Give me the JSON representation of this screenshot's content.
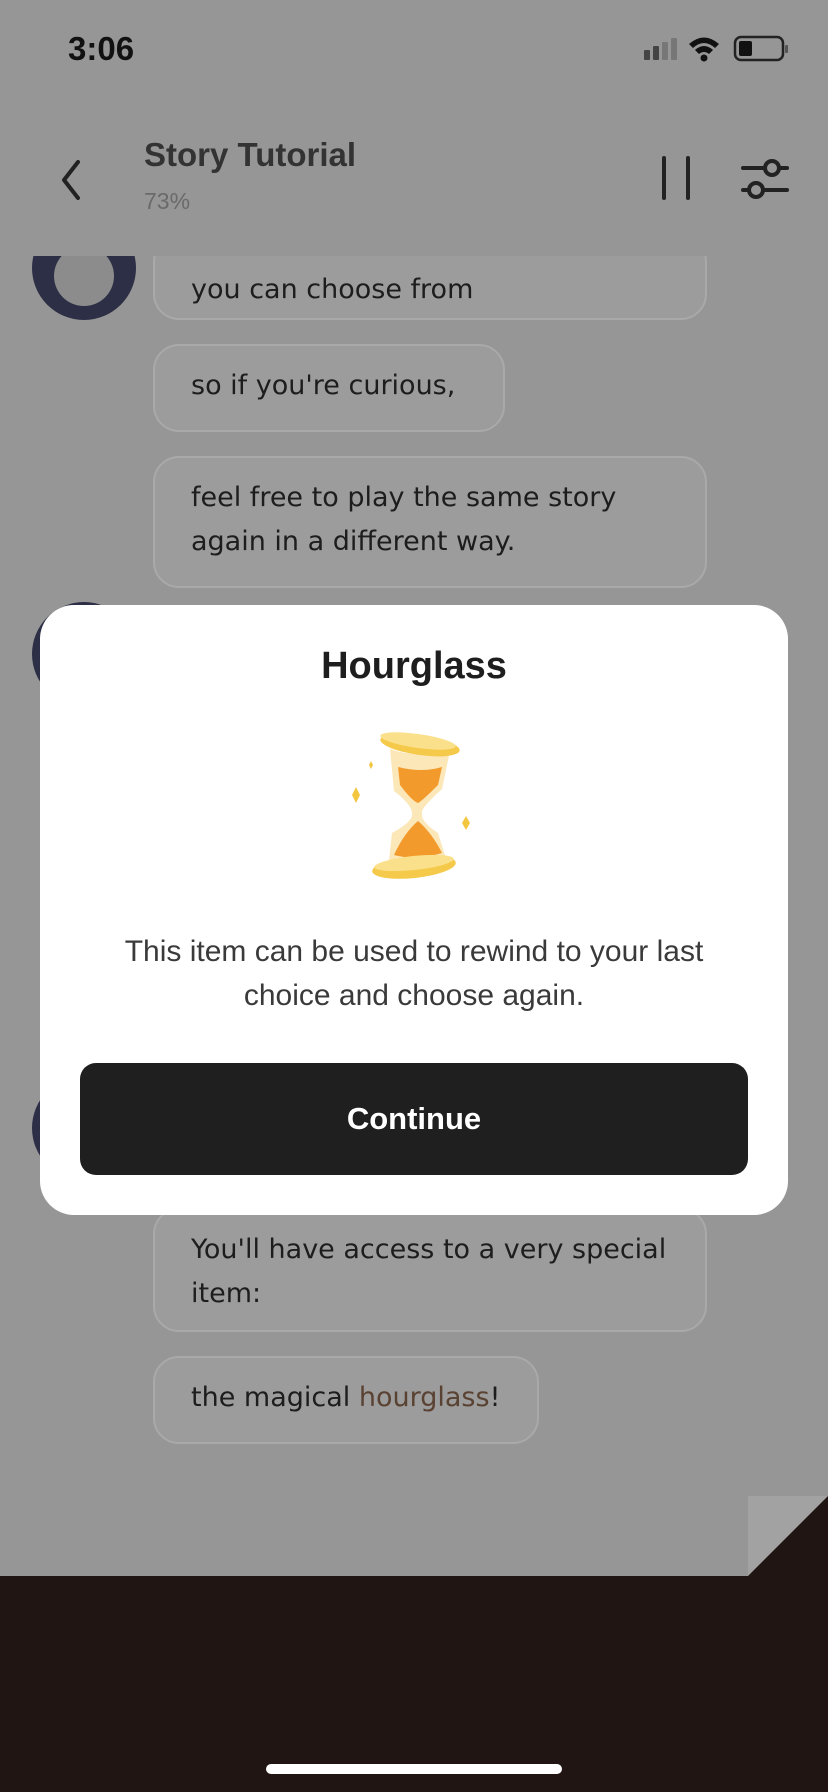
{
  "status_bar": {
    "time": "3:06"
  },
  "header": {
    "title": "Story Tutorial",
    "progress": "73%"
  },
  "chat": {
    "messages": [
      {
        "text": "you can choose from"
      },
      {
        "text": "so if you're curious,"
      },
      {
        "text": "feel free to play the same story again in a different way."
      },
      {
        "text": "You'll have access to a very special item:"
      },
      {
        "text_before": "the magical ",
        "highlight": "hourglass",
        "text_after": "!"
      }
    ]
  },
  "modal": {
    "title": "Hourglass",
    "icon": "hourglass-icon",
    "description": "This item can be used to rewind to your last choice and choose again.",
    "button_label": "Continue"
  },
  "colors": {
    "overlay_background": "#969696",
    "modal_background": "#ffffff",
    "button_background": "#1f1f1f",
    "bottom_bar": "#201512",
    "hourglass_sand": "#f39a2c",
    "hourglass_frame": "#f5c94a"
  }
}
